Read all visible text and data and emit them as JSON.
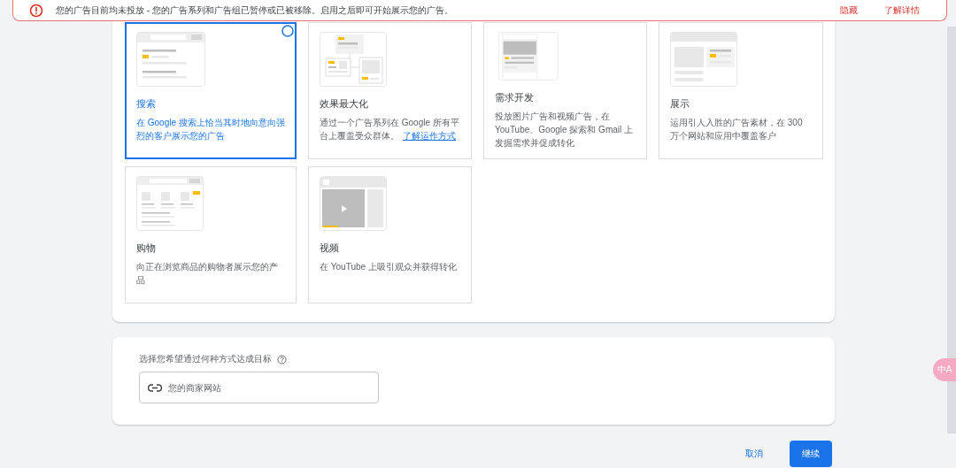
{
  "alert": {
    "message": "您的广告目前均未投放 - 您的广告系列和广告组已暂停或已被移除。启用之后即可开始展示您的广告。",
    "actions": [
      "隐藏",
      "了解详情"
    ]
  },
  "campaign_types": [
    {
      "kind": "search",
      "title": "搜索",
      "description": "在 Google 搜索上恰当其时地向意向强烈的客户展示您的广告",
      "selected": true
    },
    {
      "kind": "pmax",
      "title": "效果最大化",
      "description": "通过一个广告系列在 Google 所有平台上覆盖受众群体。",
      "link": "了解运作方式",
      "selected": false
    },
    {
      "kind": "demand",
      "title": "需求开发",
      "description": "投放图片广告和视频广告，在 YouTube、Google 探索和 Gmail 上发掘需求并促成转化",
      "selected": false
    },
    {
      "kind": "display",
      "title": "展示",
      "description": "运用引人入胜的广告素材，在 300 万个网站和应用中覆盖客户",
      "selected": false
    },
    {
      "kind": "shopping",
      "title": "购物",
      "description": "向正在浏览商品的购物者展示您的产品",
      "selected": false
    },
    {
      "kind": "video",
      "title": "视频",
      "description": "在 YouTube 上吸引观众并获得转化",
      "selected": false
    }
  ],
  "goal": {
    "label": "选择您希望通过何种方式达成目标",
    "field": {
      "placeholder": "您的商家网站"
    }
  },
  "buttons": [
    {
      "label": "取消",
      "kind": "text"
    },
    {
      "label": "继续",
      "kind": "primary"
    }
  ],
  "translate_badge": {
    "label": "中A"
  }
}
